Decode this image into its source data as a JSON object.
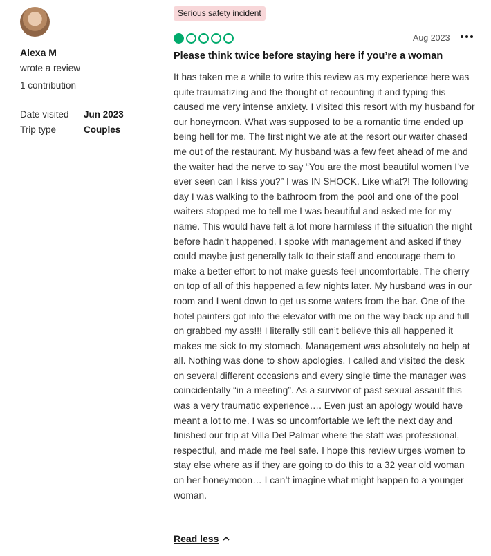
{
  "reviewer": {
    "name": "Alexa M",
    "action": "wrote a review",
    "contributions": "1 contribution",
    "date_visited_label": "Date visited",
    "date_visited_value": "Jun 2023",
    "trip_type_label": "Trip type",
    "trip_type_value": "Couples"
  },
  "review": {
    "badge": "Serious safety incident",
    "rating": 1,
    "rating_max": 5,
    "date": "Aug 2023",
    "title": "Please think twice before staying here if you’re a woman",
    "body": "It has taken me a while to write this review as my experience here was quite traumatizing and the thought of recounting it and typing this caused me very intense anxiety. I visited this resort with my husband for our honeymoon. What was supposed to be a romantic time ended up being hell for me. The first night we ate at the resort our waiter chased me out of the restaurant. My husband was a few feet ahead of me and the waiter had the nerve to say “You are the most beautiful women I’ve ever seen can I kiss you?” I was IN SHOCK. Like what?! The following day I was walking to the bathroom from the pool and one of the pool waiters stopped me to tell me I was beautiful and asked me for my name. This would have felt a lot more harmless if the situation the night before hadn’t happened. I spoke with management and asked if they could maybe just generally talk to their staff and encourage them to make a better effort to not make guests feel uncomfortable. The cherry on top of all of this happened a few nights later. My husband was in our room and I went down to get us some waters from the bar. One of the hotel painters got into the elevator with me on the way back up and full on grabbed my ass!!! I literally still can’t believe this all happened it makes me sick to my stomach. Management was absolutely no help at all. Nothing was done to show apologies. I called and visited the desk on several different occasions and every single time the manager was coincidentally “in a meeting”. As a survivor of past sexual assault this was a very traumatic experience…. Even just an apology would have meant a lot to me. I was so uncomfortable we left the next day and finished our trip at Villa Del Palmar where the staff was professional, respectful, and made me feel safe. I hope this review urges women to stay else where as if they are going to do this to a 32 year old woman on her honeymoon… I can’t imagine what might happen to a younger woman.",
    "read_less": "Read less"
  },
  "colors": {
    "rating_bubble": "#00aa6c",
    "badge_background": "#f8d7d9"
  },
  "icons": {
    "more": "more-horizontal-icon",
    "read_less": "chevron-up-icon"
  }
}
